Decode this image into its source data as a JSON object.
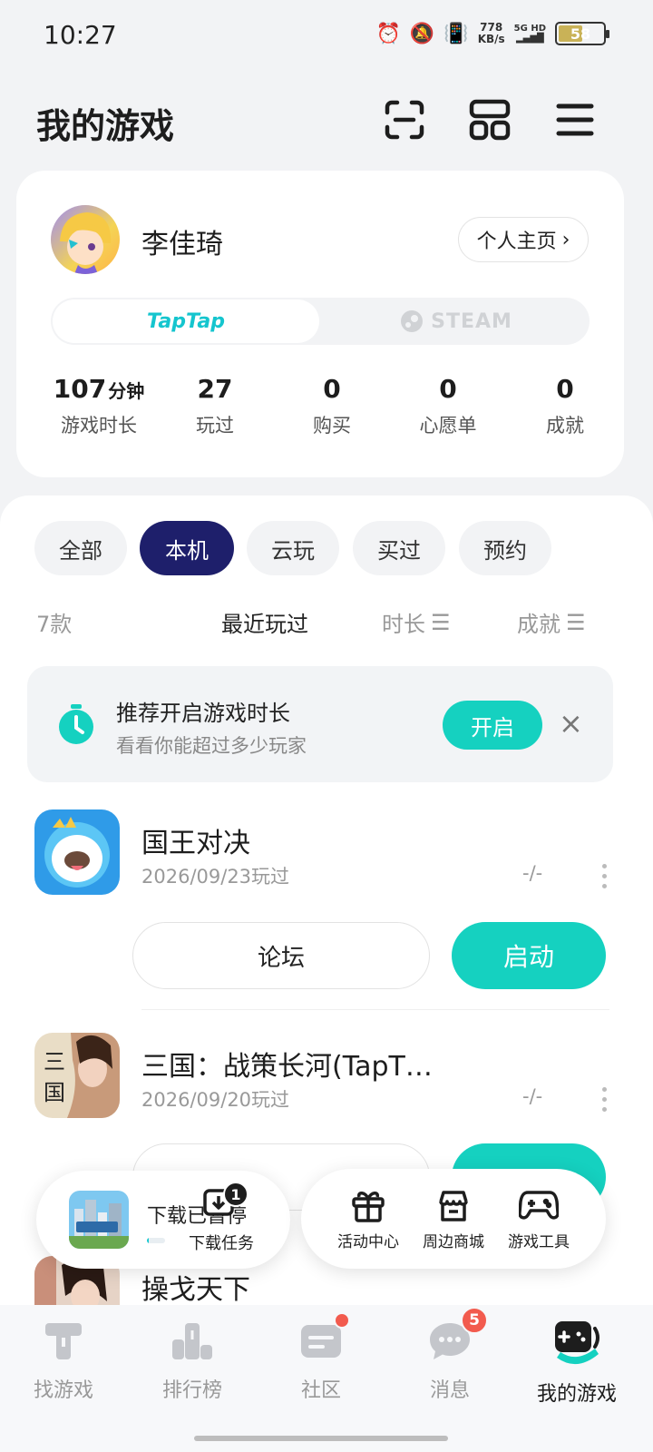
{
  "status_bar": {
    "time": "10:27",
    "net_speed_value": "778",
    "net_speed_unit": "KB/s",
    "network": "5G HD",
    "battery": "58",
    "battery_level": 0.58
  },
  "header": {
    "title": "我的游戏",
    "icons": [
      "scan-icon",
      "grid-icon",
      "menu-icon"
    ]
  },
  "profile": {
    "name": "李佳琦",
    "home_button": "个人主页",
    "platforms": {
      "active": "TapTap",
      "other": "STEAM"
    },
    "stats": [
      {
        "value": "107",
        "unit": "分钟",
        "label": "游戏时长"
      },
      {
        "value": "27",
        "unit": "",
        "label": "玩过"
      },
      {
        "value": "0",
        "unit": "",
        "label": "购买"
      },
      {
        "value": "0",
        "unit": "",
        "label": "心愿单"
      },
      {
        "value": "0",
        "unit": "",
        "label": "成就"
      }
    ]
  },
  "filters": {
    "chips": [
      "全部",
      "本机",
      "云玩",
      "买过",
      "预约"
    ],
    "active": "本机"
  },
  "sort": {
    "count": "7款",
    "options": [
      "最近玩过",
      "时长",
      "成就"
    ],
    "active": "最近玩过"
  },
  "banner": {
    "title": "推荐开启游戏时长",
    "subtitle": "看看你能超过多少玩家",
    "button": "开启"
  },
  "games": [
    {
      "title": "国王对决",
      "date": "2026/09/23玩过",
      "duration": "-/-",
      "secondary": "论坛",
      "primary": "启动"
    },
    {
      "title": "三国：战策长河(TapT…",
      "date": "2026/09/20玩过",
      "duration": "-/-"
    },
    {
      "title": "操戈天下"
    }
  ],
  "download": {
    "status": "下载已暂停",
    "task_label": "下载任务",
    "badge": "1",
    "progress": 0.02
  },
  "tools": [
    {
      "label": "活动中心",
      "icon": "gift-icon"
    },
    {
      "label": "周边商城",
      "icon": "shop-icon"
    },
    {
      "label": "游戏工具",
      "icon": "gamepad-icon"
    }
  ],
  "bottom_nav": {
    "items": [
      {
        "label": "找游戏",
        "icon": "find-games-icon"
      },
      {
        "label": "排行榜",
        "icon": "ranking-icon"
      },
      {
        "label": "社区",
        "icon": "community-icon"
      },
      {
        "label": "消息",
        "icon": "message-icon",
        "badge": "5"
      },
      {
        "label": "我的游戏",
        "icon": "my-games-icon"
      }
    ],
    "active": "我的游戏"
  }
}
